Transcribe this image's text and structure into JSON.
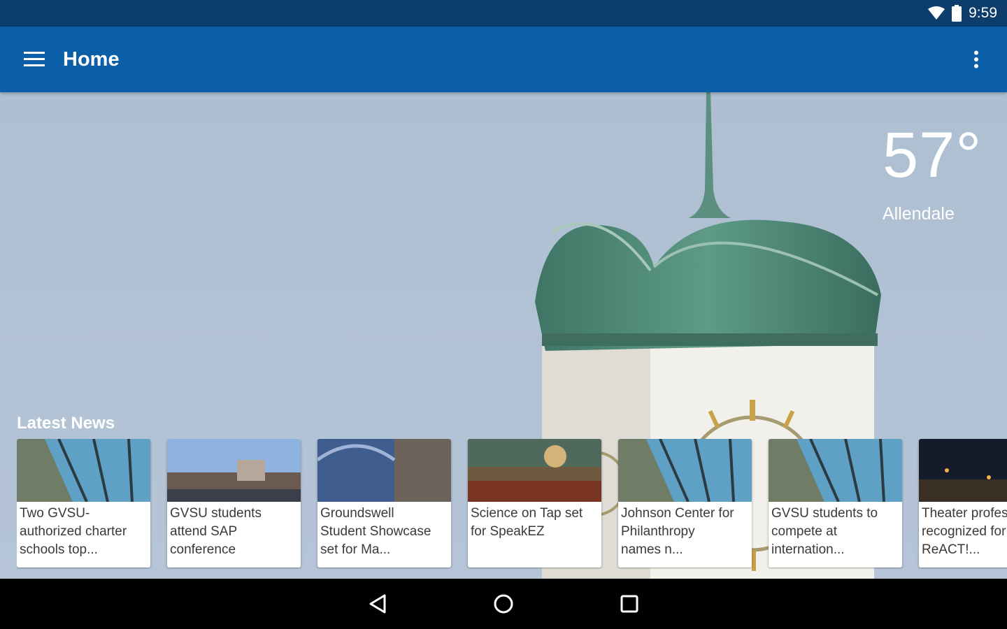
{
  "status_bar": {
    "time": "9:59",
    "icons": [
      "wifi-icon",
      "battery-icon"
    ]
  },
  "app_bar": {
    "title": "Home",
    "menu_icon": "hamburger-menu-icon",
    "overflow_icon": "more-vertical-icon"
  },
  "weather": {
    "temperature": "57°",
    "location": "Allendale"
  },
  "news": {
    "heading": "Latest News",
    "items": [
      {
        "title": "Two GVSU-\nauthorized charter\nschools top...",
        "thumb": "skywalk"
      },
      {
        "title": "GVSU students\nattend SAP\nconference",
        "thumb": "campus"
      },
      {
        "title": "Groundswell\nStudent Showcase\nset for Ma...",
        "thumb": "bridge"
      },
      {
        "title": "Science on Tap set\nfor SpeakEZ",
        "thumb": "interior"
      },
      {
        "title": "Johnson Center for\nPhilanthropy\nnames n...",
        "thumb": "skywalk"
      },
      {
        "title": "GVSU students to\ncompete at\ninternation...",
        "thumb": "skywalk"
      },
      {
        "title": "Theater professor\nrecognized for\nReACT!...",
        "thumb": "night"
      }
    ]
  },
  "nav_bar": {
    "back_icon": "back-triangle-icon",
    "home_icon": "home-circle-icon",
    "recents_icon": "recents-square-icon"
  },
  "colors": {
    "status_bar": "#0d3d6b",
    "app_bar": "#0b5fa8",
    "sky": "#b3c4d6",
    "copper": "#4f8a78"
  }
}
